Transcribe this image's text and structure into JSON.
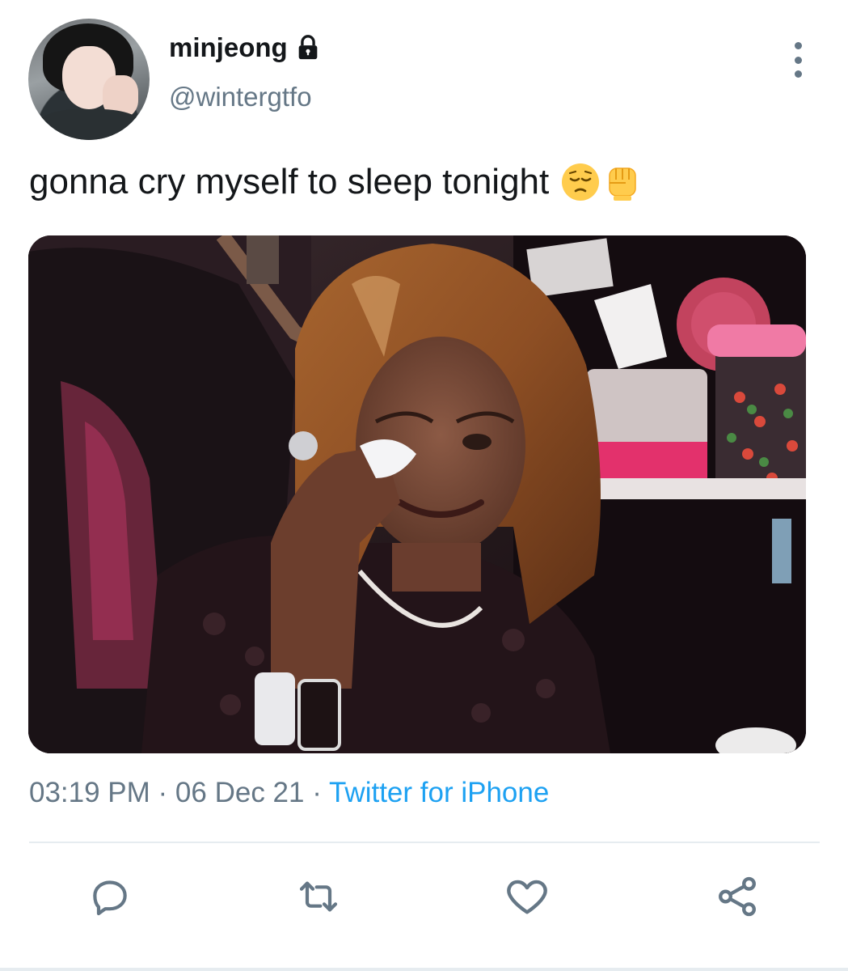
{
  "tweet": {
    "display_name": "minjeong",
    "handle": "@wintergtfo",
    "protected": true,
    "text": "gonna cry myself to sleep tonight",
    "emojis": [
      "pensive-face",
      "raised-fist"
    ],
    "time": "03:19 PM",
    "date": "06 Dec 21",
    "source": "Twitter for iPhone",
    "separator": " · "
  },
  "icons": {
    "lock": "lock-icon",
    "more": "more-vertical-icon",
    "reply": "reply-icon",
    "retweet": "retweet-icon",
    "like": "heart-icon",
    "share": "share-icon"
  },
  "colors": {
    "text": "#14171a",
    "secondary": "#657786",
    "link": "#1da1f2",
    "divider": "#e6ecf0"
  }
}
